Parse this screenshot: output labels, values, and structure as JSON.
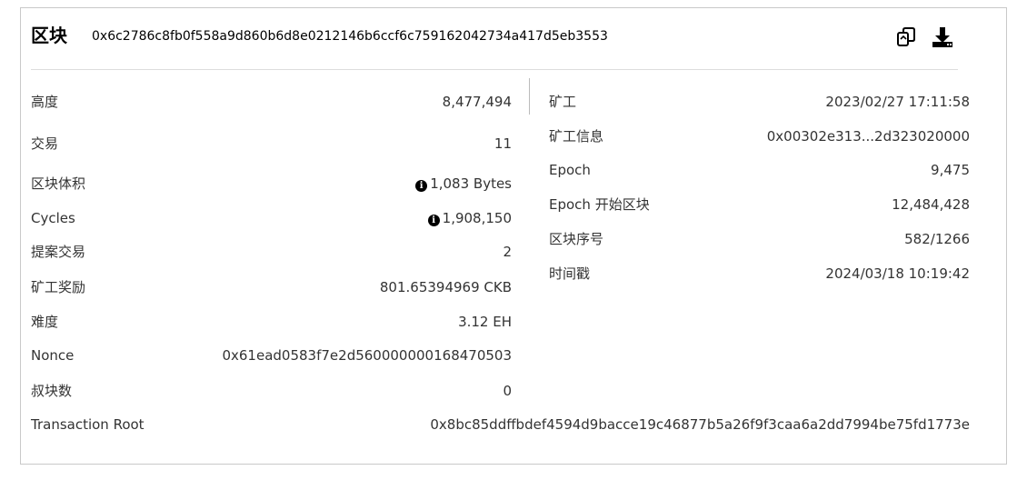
{
  "header": {
    "title": "区块",
    "hash": "0x6c2786c8fb0f558a9d860b6d8e0212146b6ccf6c759162042734a417d5eb3553",
    "copy_icon": "copy-icon",
    "download_icon": "download-icon"
  },
  "left": [
    {
      "label": "高度",
      "value": "8,477,494"
    },
    {
      "label": "交易",
      "value": "11"
    },
    {
      "label": "区块体积",
      "value": "1,083 Bytes",
      "info": "i"
    },
    {
      "label": "Cycles",
      "value": "1,908,150",
      "info": "i"
    },
    {
      "label": "提案交易",
      "value": "2"
    },
    {
      "label": "矿工奖励",
      "value": "801.65394969 CKB"
    },
    {
      "label": "难度",
      "value": "3.12 EH"
    },
    {
      "label": "Nonce",
      "value": "0x61ead0583f7e2d560000000168470503"
    },
    {
      "label": "叔块数",
      "value": "0"
    }
  ],
  "right": [
    {
      "label": "矿工",
      "value": "2023/02/27 17:11:58"
    },
    {
      "label": "矿工信息",
      "value": "0x00302e313...2d323020000"
    },
    {
      "label": "Epoch",
      "value": "9,475"
    },
    {
      "label": "Epoch 开始区块",
      "value": "12,484,428"
    },
    {
      "label": "区块序号",
      "value": "582/1266"
    },
    {
      "label": "时间戳",
      "value": "2024/03/18 10:19:42"
    }
  ],
  "transaction_root": {
    "label": "Transaction Root",
    "value": "0x8bc85ddffbdef4594d9bacce19c46877b5a26f9f3caa6a2dd7994be75fd1773e"
  }
}
